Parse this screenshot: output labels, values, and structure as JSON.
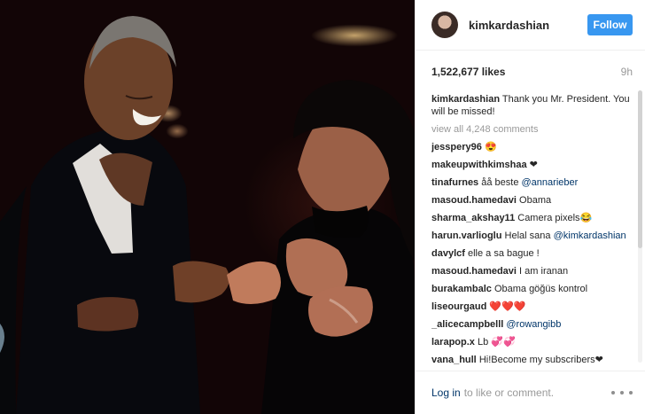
{
  "header": {
    "username": "kimkardashian",
    "follow_label": "Follow"
  },
  "stats": {
    "likes": "1,522,677 likes",
    "timestamp": "9h"
  },
  "caption": {
    "username": "kimkardashian",
    "text": "Thank you Mr. President. You will be missed!"
  },
  "view_all": "view all 4,248 comments",
  "comments": [
    {
      "user": "jesspery96",
      "text": "😍"
    },
    {
      "user": "makeupwithkimshaa",
      "text": "❤"
    },
    {
      "user": "tinafurnes",
      "text": "åå beste",
      "mention": "@annarieber"
    },
    {
      "user": "masoud.hamedavi",
      "text": "Obama"
    },
    {
      "user": "sharma_akshay11",
      "text": "Camera pixels😂"
    },
    {
      "user": "harun.varlioglu",
      "text": "Helal sana",
      "mention": "@kimkardashian"
    },
    {
      "user": "davylcf",
      "text": "elle a sa bague !"
    },
    {
      "user": "masoud.hamedavi",
      "text": "I am iranan"
    },
    {
      "user": "burakambalc",
      "text": "Obama göğüs kontrol"
    },
    {
      "user": "liseourgaud",
      "text": "❤️❤️❤️"
    },
    {
      "user": "_alicecampbelll",
      "text": "",
      "mention": "@rowangibb"
    },
    {
      "user": "larapop.x",
      "text": "Lb 💞💞"
    },
    {
      "user": "vana_hull",
      "text": "Hi!Become my subscribers❤"
    }
  ],
  "footer": {
    "login_label": "Log in",
    "rest": "to like or comment."
  },
  "colors": {
    "follow_button": "#3897f0",
    "link": "#003569",
    "muted": "#999999"
  },
  "icons": {
    "more_options": "ellipsis-icon"
  }
}
